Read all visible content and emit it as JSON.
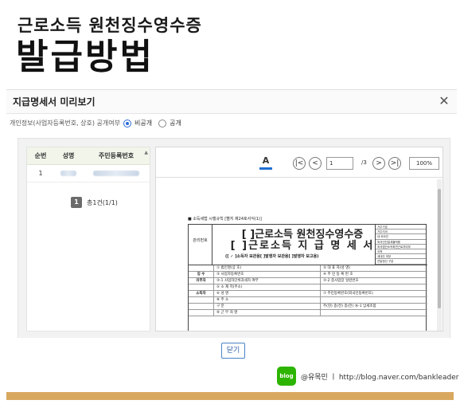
{
  "hero": {
    "subtitle": "근로소득 원천징수영수증",
    "title": "발급방법"
  },
  "dialog": {
    "title": "지급명세서 미리보기",
    "close_icon": "close-icon",
    "privacy_label": "개인정보(사업자등록번호, 상호) 공개여부",
    "privacy_options": [
      {
        "label": "비공개",
        "selected": true
      },
      {
        "label": "공개",
        "selected": false
      }
    ],
    "close_button": "닫기"
  },
  "table": {
    "headers": [
      "순번",
      "성명",
      "주민등록번호"
    ],
    "rows": [
      {
        "no": "1"
      }
    ],
    "pager": {
      "page": "1",
      "summary": "총1건(1/1)"
    }
  },
  "viewer": {
    "font_label": "A",
    "first_icon": "first-page-icon",
    "prev_icon": "prev-page-icon",
    "next_icon": "next-page-icon",
    "last_icon": "last-page-icon",
    "page_value": "1",
    "page_total": "/3",
    "zoom": "100%"
  },
  "document": {
    "caption": "■ 소득세법 시행규칙 [별지 제24호서식(1)]",
    "title_line1": "[ ]근로소득 원천징수영수증",
    "title_line2": "[ ]근로소득 지 급 명 세 서",
    "title_line3": "([ ✓ ]소득자 보관용[   ]발행자 보관용[   ]발행자 보고용)",
    "left_box": "관리번호",
    "right_grid": [
      "거주구분",
      "거주지국",
      "내·외국인",
      "외국인단일세율적용",
      "외국법인소속파견근로자여부",
      "국적",
      "세대주 여부",
      "연말정산 구분"
    ],
    "rows": [
      {
        "label": "",
        "f1": "① 법인명(상 호)",
        "f2": "② 대 표 자(성 명)"
      },
      {
        "label": "징 수",
        "f1": "③ 사업자등록번호",
        "f2": "④ 주 민 등 록 번 호"
      },
      {
        "label": "의무자",
        "f1": "③-1 사업자단위과세자 여부",
        "f2": "③-2 종사업장 일련번호"
      },
      {
        "label": "",
        "f1": "⑤ 소 재 지(주소)",
        "f2": ""
      },
      {
        "label": "소득자",
        "f1": "⑥ 성    명",
        "f2": "⑦ 주민등록번호(외국인등록번호)"
      },
      {
        "label": "",
        "f1": "⑧ 주    소",
        "f2": ""
      },
      {
        "label": "",
        "f1": "구    분",
        "f2": "주(현)    종(전)    종(전)    ⑯-1 납세조합"
      },
      {
        "label": "",
        "f1": "⑨ 근 무 처 명",
        "f2": ""
      }
    ]
  },
  "footer": {
    "logo": "blog",
    "text": "@유목민 ㅣ http://blog.naver.com/bankleader"
  },
  "colors": {
    "accent": "#2a6ad8",
    "footer_bar": "#d9a860",
    "blog_green": "#2db400"
  }
}
